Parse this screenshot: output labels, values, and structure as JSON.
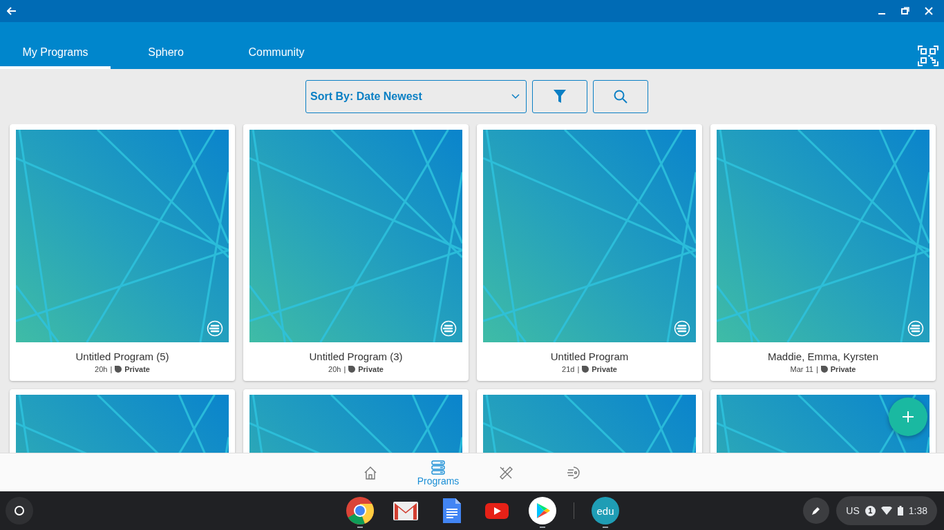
{
  "tabs": [
    {
      "label": "My Programs",
      "selected": true
    },
    {
      "label": "Sphero",
      "selected": false
    },
    {
      "label": "Community",
      "selected": false
    }
  ],
  "sort": {
    "value": "Sort By: Date Newest"
  },
  "programs": [
    {
      "kind": "program",
      "title": "Untitled Program (5)",
      "age": "20h",
      "separator": "|",
      "visibility": "Private"
    },
    {
      "kind": "program",
      "title": "Untitled Program (3)",
      "age": "20h",
      "separator": "|",
      "visibility": "Private"
    },
    {
      "kind": "program",
      "title": "Untitled Program",
      "age": "21d",
      "separator": "|",
      "visibility": "Private"
    },
    {
      "kind": "program",
      "title": "Maddie, Emma, Kyrsten",
      "age": "Mar 11",
      "separator": "|",
      "visibility": "Private"
    },
    {
      "kind": "picture"
    },
    {
      "kind": "picture"
    },
    {
      "kind": "picture"
    },
    {
      "kind": "picture"
    }
  ],
  "bottom_nav": [
    {
      "kind": "home",
      "selected": false
    },
    {
      "kind": "programs",
      "label": "Programs",
      "selected": true
    },
    {
      "kind": "tools",
      "selected": false
    },
    {
      "kind": "robot",
      "selected": false
    }
  ],
  "shelf": {
    "apps": [
      {
        "kind": "chrome",
        "running": true
      },
      {
        "kind": "gmail",
        "running": false
      },
      {
        "kind": "docs",
        "running": false
      },
      {
        "kind": "youtube",
        "running": false
      },
      {
        "kind": "play",
        "running": true
      },
      {
        "kind": "edu",
        "label": "edu",
        "running": true
      }
    ],
    "status": {
      "keyboard": "US",
      "notifications": "1",
      "time": "1:38"
    }
  }
}
